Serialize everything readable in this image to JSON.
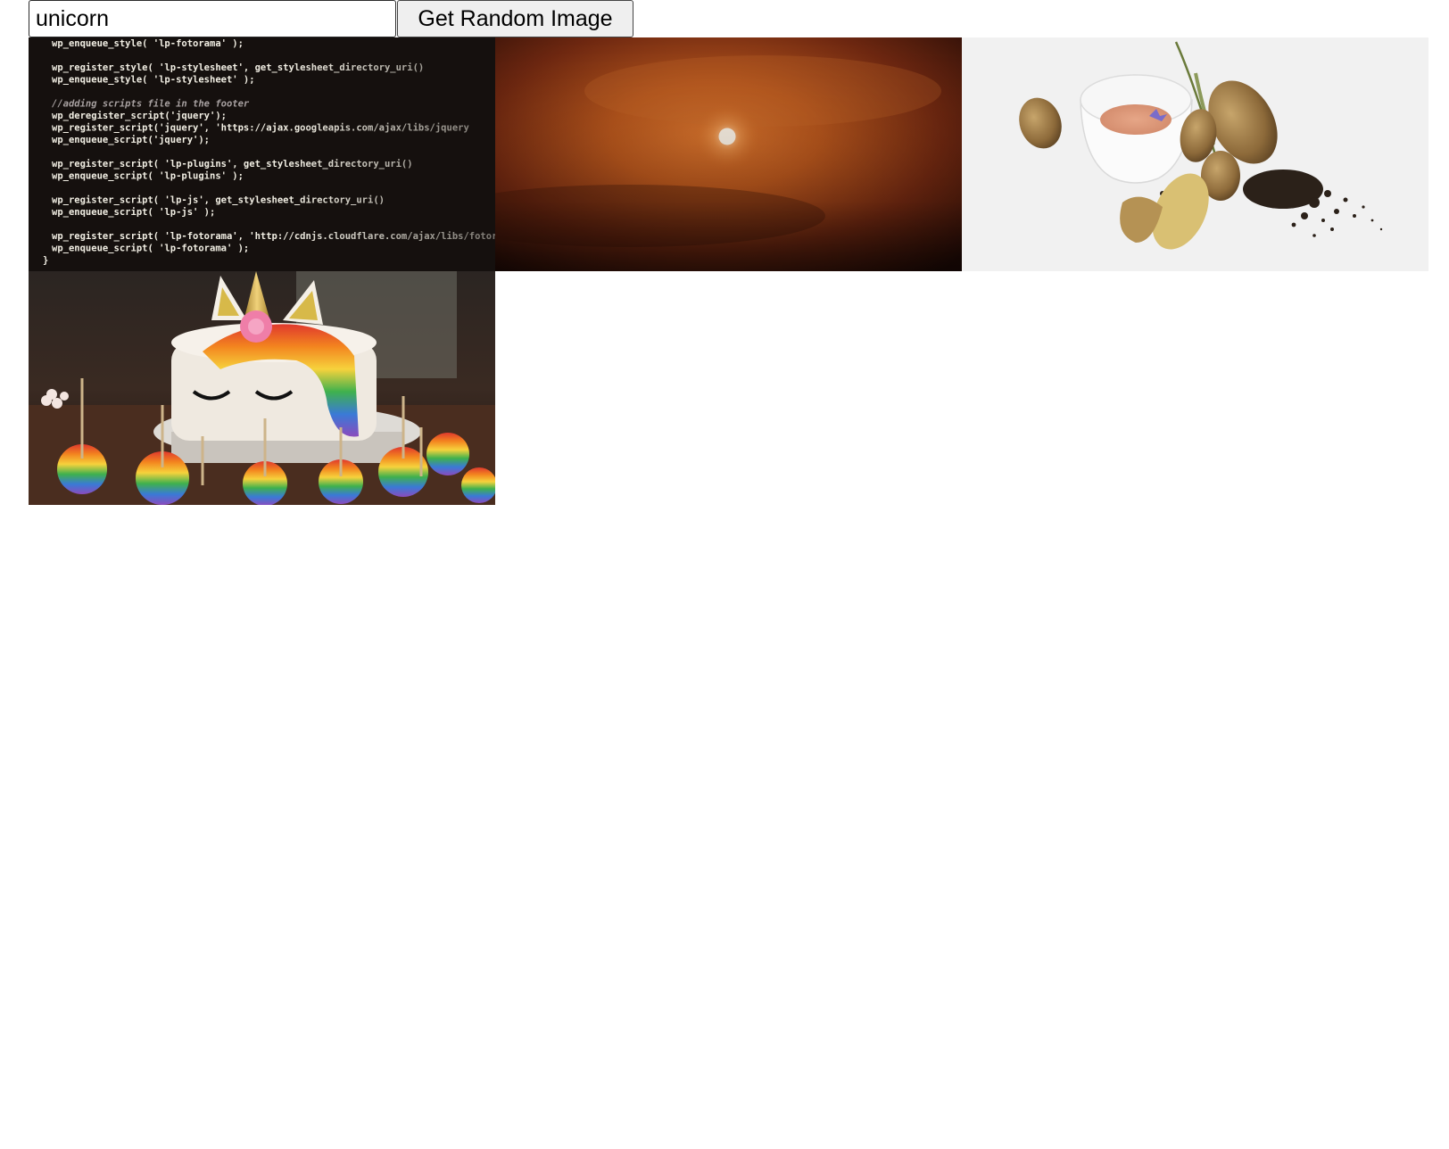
{
  "search": {
    "value": "unicorn"
  },
  "button": {
    "label": "Get Random Image"
  },
  "images": [
    {
      "subject": "code-screenshot",
      "code_lines": [
        "wp_enqueue_style( 'lp-fotorama' );",
        "",
        "wp_register_style( 'lp-stylesheet', get_stylesheet_directory_uri()",
        "wp_enqueue_style( 'lp-stylesheet' );",
        "",
        "//adding scripts file in the footer",
        "wp_deregister_script('jquery');",
        "wp_register_script('jquery', 'https://ajax.googleapis.com/ajax/libs/jquery",
        "wp_enqueue_script('jquery');",
        "",
        "wp_register_script( 'lp-plugins', get_stylesheet_directory_uri()",
        "wp_enqueue_script( 'lp-plugins' );",
        "",
        "wp_register_script( 'lp-js', get_stylesheet_directory_uri()",
        "wp_enqueue_script( 'lp-js' );",
        "",
        "wp_register_script( 'lp-fotorama', 'http://cdnjs.cloudflare.com/ajax/libs/fotorama",
        "wp_enqueue_script( 'lp-fotorama' );",
        "}"
      ]
    },
    {
      "subject": "orange-sky-sun"
    },
    {
      "subject": "potatoes-and-cup"
    },
    {
      "subject": "unicorn-cake-cupcakes"
    }
  ],
  "colors": {
    "code_bg": "#15100e",
    "code_text": "#f2efe4",
    "code_comment": "#a7a0a0",
    "sky_orange": "#b8581d",
    "sky_dark": "#2d1009",
    "sun": "#f8efe2",
    "potato_bg": "#f0f0f0",
    "cake_white": "#efe9e0"
  }
}
